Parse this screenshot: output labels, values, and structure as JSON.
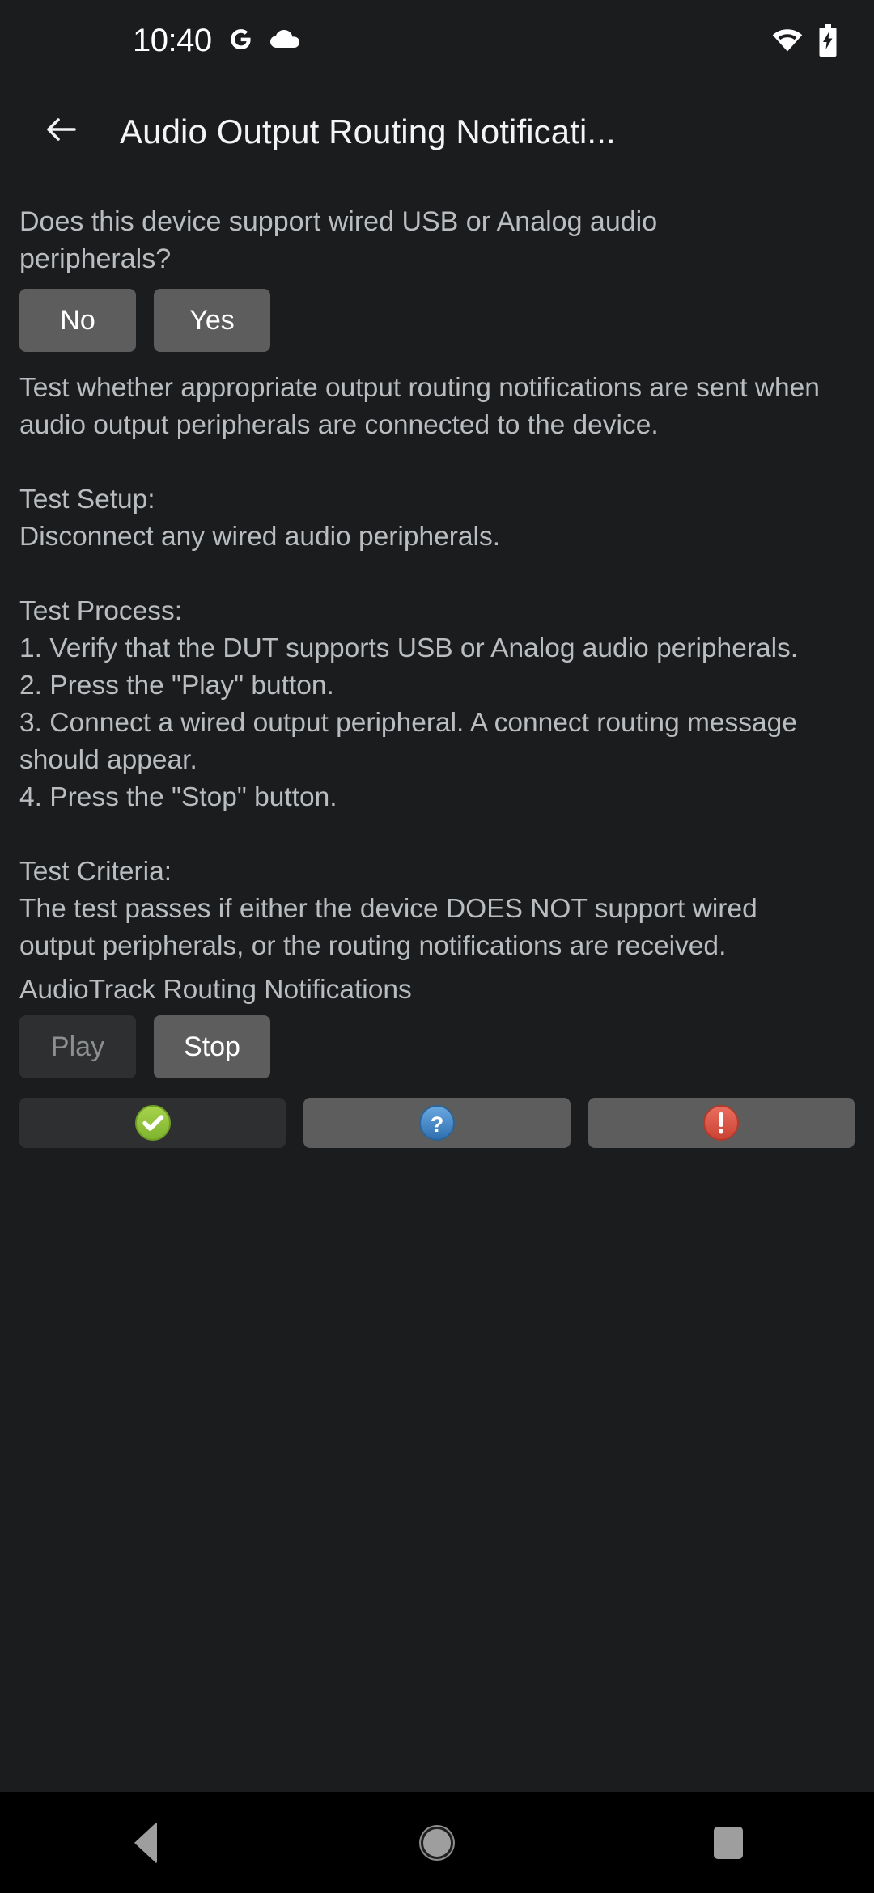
{
  "status_bar": {
    "time": "10:40",
    "icons": [
      "google-g-icon",
      "cloud-icon",
      "wifi-icon",
      "battery-charging-icon"
    ]
  },
  "app_bar": {
    "back_icon": "arrow-left-icon",
    "title": "Audio Output Routing Notificati..."
  },
  "content": {
    "question": "Does this device support wired USB or Analog audio peripherals?",
    "no_label": "No",
    "yes_label": "Yes",
    "description": "Test whether appropriate output routing notifications are sent when audio output peripherals are connected to the device.\n\nTest Setup:\nDisconnect any wired audio peripherals.\n\nTest Process:\n1. Verify that the DUT supports USB or Analog audio peripherals.\n2. Press the \"Play\" button.\n3. Connect a wired output peripheral. A connect routing message should appear.\n4. Press the \"Stop\" button.\n\nTest Criteria:\nThe test passes if either the device DOES NOT support wired output peripherals, or the routing notifications are received.",
    "section_label": "AudioTrack Routing Notifications",
    "play_label": "Play",
    "stop_label": "Stop",
    "verdict": {
      "pass_icon": "check-circle-icon",
      "info_icon": "question-circle-icon",
      "fail_icon": "exclamation-circle-icon"
    }
  },
  "nav_bar": {
    "back": "nav-back-icon",
    "home": "nav-home-icon",
    "recents": "nav-recents-icon"
  },
  "colors": {
    "background": "#1b1c1e",
    "button_enabled": "#5d5d5d",
    "button_disabled": "#2e2f30",
    "text_primary": "#f4f4f4",
    "text_secondary": "#b9bdc0",
    "pass_green": "#8dc63f",
    "info_blue": "#4a8fd0",
    "fail_red": "#df5b4a"
  }
}
